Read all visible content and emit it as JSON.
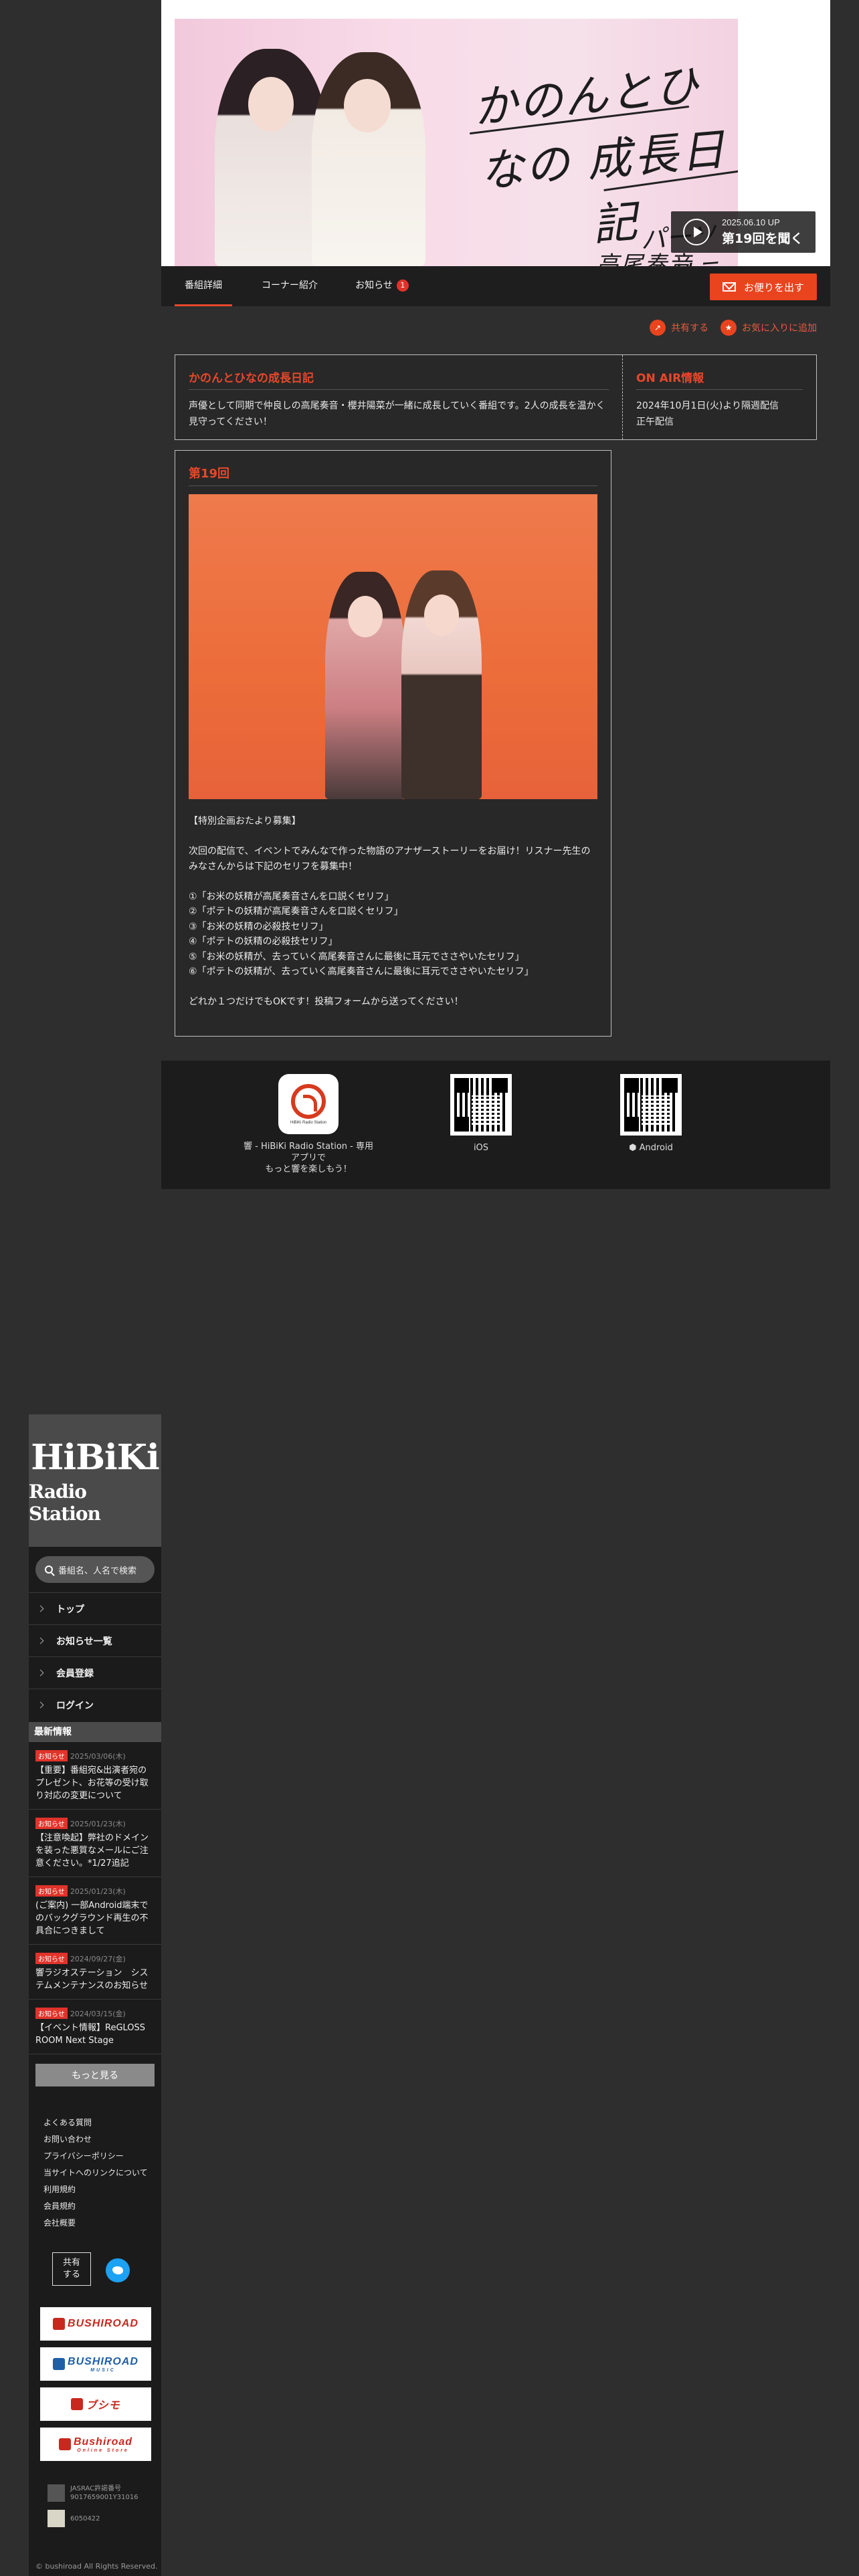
{
  "banner": {
    "title_line1": "かのんとひなの",
    "title_line2": "成長日記",
    "personality_label": "パーソナリティ",
    "personality_names": "高尾奏音",
    "play_date": "2025.06.10 UP",
    "play_label": "第19回を聞く"
  },
  "tabs": {
    "details": "番組詳細",
    "corners": "コーナー紹介",
    "news": "お知らせ",
    "news_count": "1",
    "letter_button": "お便りを出す"
  },
  "actions": {
    "share": "共有する",
    "favorite": "お気に入りに追加"
  },
  "program": {
    "title": "かのんとひなの成長日記",
    "description": "声優として同期で仲良しの高尾奏音・櫻井陽菜が一緒に成長していく番組です。2人の成長を温かく見守ってください！",
    "onair_title": "ON AIR情報",
    "onair_text": "2024年10月1日(火)より隔週配信\n正午配信"
  },
  "episode": {
    "title": "第19回",
    "body": [
      "【特別企画おたより募集】",
      "",
      "次回の配信で、イベントでみんなで作った物語のアナザーストーリーをお届け！リスナー先生のみなさんからは下記のセリフを募集中！",
      "",
      "①「お米の妖精が高尾奏音さんを口説くセリフ」",
      "②「ポテトの妖精が高尾奏音さんを口説くセリフ」",
      "③「お米の妖精の必殺技セリフ」",
      "④「ポテトの妖精の必殺技セリフ」",
      "⑤「お米の妖精が、去っていく高尾奏音さんに最後に耳元でささやいたセリフ」",
      "⑥「ポテトの妖精が、去っていく高尾奏音さんに最後に耳元でささやいたセリフ」",
      "",
      "どれか１つだけでもOKです！投稿フォームから送ってください！"
    ]
  },
  "apps": {
    "app_caption": "響 - HiBiKi Radio Station - 専用アプリで\nもっと響を楽しもう！",
    "app_icon_text": "HiBiKi Radio Station",
    "ios_label": " iOS",
    "android_label": " Android"
  },
  "sidebar": {
    "logo_line1": "HiBiKi",
    "logo_line2": "Radio Station",
    "search_placeholder": "番組名、人名で検索",
    "nav": [
      "トップ",
      "お知らせ一覧",
      "会員登録",
      "ログイン"
    ],
    "news_heading": "最新情報",
    "news": [
      {
        "tag": "お知らせ",
        "date": "2025/03/06(木)",
        "text": "【重要】番組宛&出演者宛のプレゼント、お花等の受け取り対応の変更について"
      },
      {
        "tag": "お知らせ",
        "date": "2025/01/23(木)",
        "text": "【注意喚起】弊社のドメインを装った悪質なメールにご注意ください。*1/27追記"
      },
      {
        "tag": "お知らせ",
        "date": "2025/01/23(木)",
        "text": "(ご案内) 一部Android端末でのバックグラウンド再生の不具合につきまして"
      },
      {
        "tag": "お知らせ",
        "date": "2024/09/27(金)",
        "text": "響ラジオステーション　システムメンテナンスのお知らせ"
      },
      {
        "tag": "お知らせ",
        "date": "2024/03/15(金)",
        "text": "【イベント情報】ReGLOSS ROOM Next Stage"
      }
    ],
    "more": "もっと見る",
    "links": [
      "よくある質問",
      "お問い合わせ",
      "プライバシーポリシー",
      "当サイトへのリンクについて",
      "利用規約",
      "会員規約",
      "会社概要"
    ],
    "share_label": "共有\nする",
    "banners": [
      {
        "main": "BUSHIROAD",
        "sub": ""
      },
      {
        "main": "BUSHIROAD",
        "sub": "MUSIC"
      },
      {
        "main": "ブシモ",
        "sub": ""
      },
      {
        "main": "Bushiroad",
        "sub": "Online Store"
      }
    ],
    "cert1": "JASRAC許諾番号\n9017659001Y31016",
    "cert2": "6050422",
    "copyright": "© bushiroad All Rights Reserved."
  }
}
